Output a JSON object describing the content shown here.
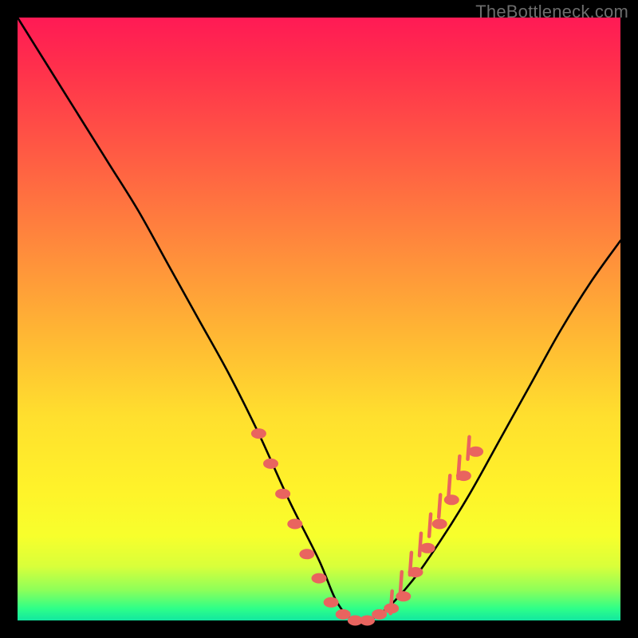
{
  "watermark": "TheBottleneck.com",
  "colors": {
    "frame": "#000000",
    "curve": "#000000",
    "marker": "#e9645f",
    "gradient_stops": [
      "#ff1a55",
      "#ff5944",
      "#ffb534",
      "#fff22a",
      "#2fff88",
      "#12e7a0"
    ]
  },
  "chart_data": {
    "type": "line",
    "title": "",
    "xlabel": "",
    "ylabel": "",
    "xlim": [
      0,
      100
    ],
    "ylim": [
      0,
      100
    ],
    "grid": false,
    "legend": false,
    "notes": "V-shaped bottleneck curve on a heat gradient. Y-axis reads as mismatch/bottleneck percentage (100 at top, 0 at bottom). Minimum (optimal match) is near x≈56 where y≈0. Pink markers cluster around the trough and partway up the right branch.",
    "series": [
      {
        "name": "bottleneck-curve",
        "x": [
          0,
          5,
          10,
          15,
          20,
          25,
          30,
          35,
          40,
          45,
          50,
          53,
          56,
          60,
          65,
          70,
          75,
          80,
          85,
          90,
          95,
          100
        ],
        "y": [
          100,
          92,
          84,
          76,
          68,
          59,
          50,
          41,
          31,
          20,
          10,
          3,
          0,
          1,
          6,
          13,
          21,
          30,
          39,
          48,
          56,
          63
        ]
      }
    ],
    "markers": [
      {
        "x": 40,
        "y": 31
      },
      {
        "x": 42,
        "y": 26
      },
      {
        "x": 44,
        "y": 21
      },
      {
        "x": 46,
        "y": 16
      },
      {
        "x": 48,
        "y": 11
      },
      {
        "x": 50,
        "y": 7
      },
      {
        "x": 52,
        "y": 3
      },
      {
        "x": 54,
        "y": 1
      },
      {
        "x": 56,
        "y": 0
      },
      {
        "x": 58,
        "y": 0
      },
      {
        "x": 60,
        "y": 1
      },
      {
        "x": 62,
        "y": 2
      },
      {
        "x": 64,
        "y": 4
      },
      {
        "x": 66,
        "y": 8
      },
      {
        "x": 68,
        "y": 12
      },
      {
        "x": 70,
        "y": 16
      },
      {
        "x": 72,
        "y": 20
      },
      {
        "x": 74,
        "y": 24
      },
      {
        "x": 76,
        "y": 28
      }
    ]
  }
}
